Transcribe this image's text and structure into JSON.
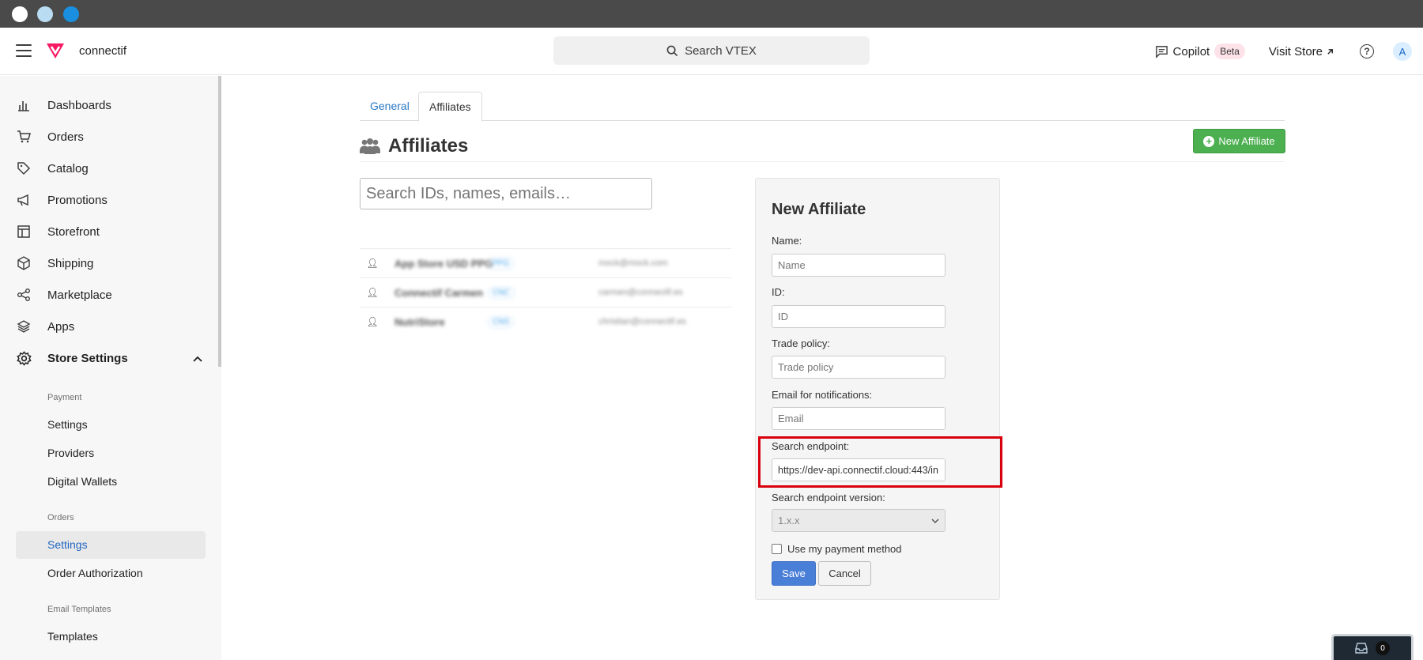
{
  "topbar": {
    "store_name": "connectif",
    "search_placeholder": "Search VTEX",
    "copilot_label": "Copilot",
    "beta_label": "Beta",
    "visit_store_label": "Visit Store",
    "avatar_initial": "A"
  },
  "sidebar": {
    "items": [
      {
        "label": "Dashboards",
        "icon": "bar-chart-icon"
      },
      {
        "label": "Orders",
        "icon": "cart-icon"
      },
      {
        "label": "Catalog",
        "icon": "tag-icon"
      },
      {
        "label": "Promotions",
        "icon": "megaphone-icon"
      },
      {
        "label": "Storefront",
        "icon": "layout-icon"
      },
      {
        "label": "Shipping",
        "icon": "box-icon"
      },
      {
        "label": "Marketplace",
        "icon": "share-nodes-icon"
      },
      {
        "label": "Apps",
        "icon": "layers-icon"
      },
      {
        "label": "Store Settings",
        "icon": "gear-icon"
      }
    ],
    "groups": [
      {
        "heading": "Payment",
        "items": [
          "Settings",
          "Providers",
          "Digital Wallets"
        ]
      },
      {
        "heading": "Orders",
        "items": [
          "Settings",
          "Order Authorization"
        ]
      },
      {
        "heading": "Email Templates",
        "items": [
          "Templates"
        ]
      }
    ]
  },
  "main": {
    "tabs": [
      "General",
      "Affiliates"
    ],
    "title": "Affiliates",
    "new_affiliate_label": "New Affiliate",
    "search_placeholder": "Search IDs, names, emails…",
    "affiliates": [
      {
        "name": "App Store USD PPG",
        "id": "PPG",
        "email": "mock@mock.com"
      },
      {
        "name": "Connectif Carmen",
        "id": "CNC",
        "email": "carmen@connectif.es"
      },
      {
        "name": "NutriStore",
        "id": "CNS",
        "email": "christian@connectif.es"
      }
    ]
  },
  "form": {
    "title": "New Affiliate",
    "name_label": "Name:",
    "name_placeholder": "Name",
    "id_label": "ID:",
    "id_placeholder": "ID",
    "trade_policy_label": "Trade policy:",
    "trade_policy_placeholder": "Trade policy",
    "email_label": "Email for notifications:",
    "email_placeholder": "Email",
    "endpoint_label": "Search endpoint:",
    "endpoint_value": "https://dev-api.connectif.cloud:443/in",
    "endpoint_version_label": "Search endpoint version:",
    "endpoint_version_value": "1.x.x",
    "payment_label": "Use my payment method",
    "save_label": "Save",
    "cancel_label": "Cancel"
  },
  "widget": {
    "count": "0"
  },
  "colors": {
    "accent": "#1f65c0",
    "success": "#4caf50",
    "highlight": "#d9000d",
    "brand": "#f71963"
  }
}
